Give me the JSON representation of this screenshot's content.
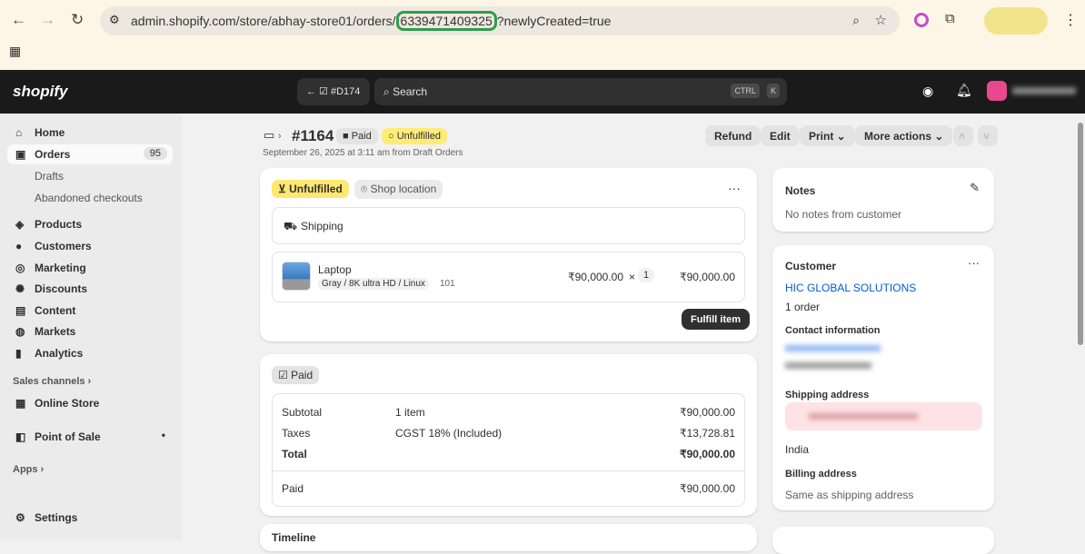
{
  "browser": {
    "url_prefix": "admin.shopify.com/store/abhay-store01/orders/",
    "url_id": "6339471409325",
    "url_suffix": "?newlyCreated=true"
  },
  "topbar": {
    "logo": "shopify",
    "draft": "#D174",
    "search_placeholder": "Search",
    "kbd1": "CTRL",
    "kbd2": "K"
  },
  "sidebar": {
    "items": [
      {
        "label": "Home",
        "icon": "home-icon"
      },
      {
        "label": "Orders",
        "badge": "95",
        "icon": "orders-icon"
      },
      {
        "label": "Products"
      },
      {
        "label": "Customers"
      },
      {
        "label": "Marketing"
      },
      {
        "label": "Discounts"
      },
      {
        "label": "Content"
      },
      {
        "label": "Markets"
      },
      {
        "label": "Analytics"
      }
    ],
    "subitems": [
      "Drafts",
      "Abandoned checkouts"
    ],
    "sales_channels": "Sales channels",
    "online_store": "Online Store",
    "pos": "Point of Sale",
    "apps": "Apps",
    "settings": "Settings"
  },
  "order": {
    "number": "#1164",
    "paid_badge": "Paid",
    "unfulfilled_badge": "Unfulfilled",
    "subtitle": "September 26, 2025 at 3:11 am from Draft Orders",
    "actions": {
      "refund": "Refund",
      "edit": "Edit",
      "print": "Print",
      "more": "More actions"
    }
  },
  "fulfillment": {
    "status": "Unfulfilled",
    "location": "Shop location",
    "shipping": "Shipping",
    "item": {
      "name": "Laptop",
      "variant": "Gray / 8K ultra HD / Linux",
      "sku": "101",
      "price": "₹90,000.00",
      "qty": "1",
      "total": "₹90,000.00"
    },
    "fulfill_button": "Fulfill item"
  },
  "payment": {
    "status": "Paid",
    "rows": [
      {
        "label": "Subtotal",
        "desc": "1 item",
        "amount": "₹90,000.00"
      },
      {
        "label": "Taxes",
        "desc": "CGST 18% (Included)",
        "amount": "₹13,728.81"
      },
      {
        "label": "Total",
        "desc": "",
        "amount": "₹90,000.00"
      }
    ],
    "paid_label": "Paid",
    "paid_amount": "₹90,000.00"
  },
  "timeline": "Timeline",
  "notes": {
    "title": "Notes",
    "text": "No notes from customer"
  },
  "customer": {
    "title": "Customer",
    "name": "HIC GLOBAL SOLUTIONS",
    "orders": "1 order",
    "contact_title": "Contact information",
    "shipping_title": "Shipping address",
    "country": "India",
    "billing_title": "Billing address",
    "billing_text": "Same as shipping address"
  }
}
